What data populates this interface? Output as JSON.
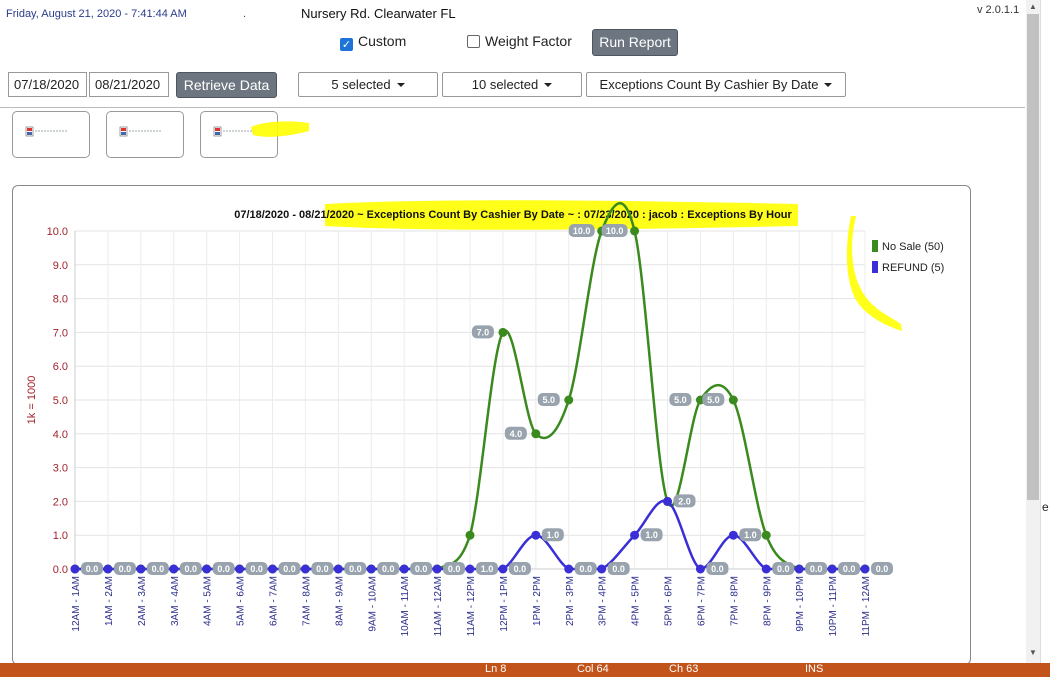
{
  "header": {
    "datetime": "Friday, August 21, 2020 - 7:41:44 AM",
    "dot": ".",
    "location": "Nursery Rd. Clearwater FL",
    "version": "v 2.0.1.1"
  },
  "options": {
    "custom_label": "Custom",
    "custom_checked": true,
    "weight_label": "Weight Factor",
    "weight_checked": false,
    "run_report_label": "Run Report"
  },
  "filters": {
    "start_date": "07/18/2020",
    "end_date": "08/21/2020",
    "retrieve_label": "Retrieve Data",
    "dropdown1": "5 selected",
    "dropdown2": "10 selected",
    "dropdown3": "Exceptions Count By Cashier By Date"
  },
  "chart_data": {
    "type": "line",
    "title": "07/18/2020 - 08/21/2020 ~ Exceptions Count By Cashier By Date ~  : 07/23/2020 : jacob : Exceptions By Hour",
    "ylabel": "1k = 1000",
    "xlabel": "",
    "ylim": [
      0,
      10
    ],
    "yticks": [
      "0.0",
      "1.0",
      "2.0",
      "3.0",
      "4.0",
      "5.0",
      "6.0",
      "7.0",
      "8.0",
      "9.0",
      "10.0"
    ],
    "grid": true,
    "legend_position": "top-right",
    "categories": [
      "12AM - 1AM",
      "1AM - 2AM",
      "2AM - 3AM",
      "3AM - 4AM",
      "4AM - 5AM",
      "5AM - 6AM",
      "6AM - 7AM",
      "7AM - 8AM",
      "8AM - 9AM",
      "9AM - 10AM",
      "10AM - 11AM",
      "11AM - 12AM",
      "11AM - 12PM",
      "12PM - 1PM",
      "1PM - 2PM",
      "2PM - 3PM",
      "3PM - 4PM",
      "4PM - 5PM",
      "5PM - 6PM",
      "6PM - 7PM",
      "7PM - 8PM",
      "8PM - 9PM",
      "9PM - 10PM",
      "10PM - 11PM",
      "11PM - 12AM"
    ],
    "series": [
      {
        "name": "No Sale (50)",
        "color": "#3a8a1e",
        "values": [
          0,
          0,
          0,
          0,
          0,
          0,
          0,
          0,
          0,
          0,
          0,
          0,
          1,
          7,
          4,
          5,
          10,
          10,
          2,
          5,
          5,
          1,
          0,
          0,
          0
        ]
      },
      {
        "name": "REFUND (5)",
        "color": "#3a2fd6",
        "values": [
          0,
          0,
          0,
          0,
          0,
          0,
          0,
          0,
          0,
          0,
          0,
          0,
          0,
          0,
          1,
          0,
          0,
          1,
          2,
          0,
          1,
          0,
          0,
          0,
          0
        ]
      }
    ],
    "data_labels": {
      "series1_indices": [
        13,
        14,
        15,
        16,
        17,
        19,
        20
      ],
      "series2_indices": [
        0,
        1,
        2,
        3,
        4,
        5,
        6,
        7,
        8,
        9,
        10,
        11,
        12,
        13,
        14,
        15,
        16,
        17,
        18,
        19,
        20,
        21,
        22,
        23,
        24
      ],
      "series2_overrides": {
        "12": 1,
        "13": 0,
        "14": 1,
        "15": 0,
        "16": 0,
        "17": 1,
        "18": 2,
        "19": 0,
        "20": 1,
        "21": 0
      }
    }
  },
  "statusbar": {
    "ln": "Ln 8",
    "col": "Col 64",
    "ch": "Ch 63",
    "mode": "INS"
  },
  "edge_char": "e"
}
